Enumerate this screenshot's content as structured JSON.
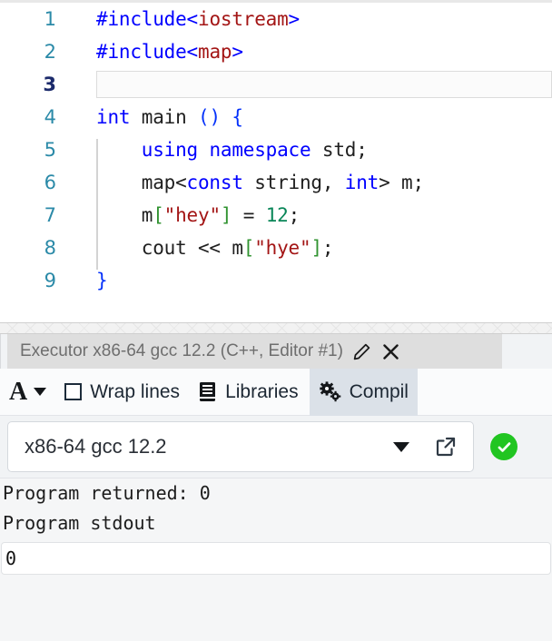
{
  "editor": {
    "active_line": 3,
    "lines": [
      {
        "num": "1",
        "tokens": [
          {
            "t": "#include",
            "c": "pre"
          },
          {
            "t": "<",
            "c": "pre"
          },
          {
            "t": "iostream",
            "c": "str"
          },
          {
            "t": ">",
            "c": "pre"
          }
        ]
      },
      {
        "num": "2",
        "tokens": [
          {
            "t": "#include",
            "c": "pre"
          },
          {
            "t": "<",
            "c": "pre"
          },
          {
            "t": "map",
            "c": "str"
          },
          {
            "t": ">",
            "c": "pre"
          }
        ]
      },
      {
        "num": "3",
        "tokens": []
      },
      {
        "num": "4",
        "tokens": [
          {
            "t": "int",
            "c": "key"
          },
          {
            "t": " main ",
            "c": "plain"
          },
          {
            "t": "()",
            "c": "brace"
          },
          {
            "t": " ",
            "c": "plain"
          },
          {
            "t": "{",
            "c": "brace"
          }
        ]
      },
      {
        "num": "5",
        "tokens": [
          {
            "t": "    ",
            "c": "plain"
          },
          {
            "t": "using namespace",
            "c": "key"
          },
          {
            "t": " std;",
            "c": "plain"
          }
        ]
      },
      {
        "num": "6",
        "tokens": [
          {
            "t": "    map<",
            "c": "plain"
          },
          {
            "t": "const",
            "c": "key"
          },
          {
            "t": " string, ",
            "c": "plain"
          },
          {
            "t": "int",
            "c": "key"
          },
          {
            "t": "> m;",
            "c": "plain"
          }
        ]
      },
      {
        "num": "7",
        "tokens": [
          {
            "t": "    m",
            "c": "plain"
          },
          {
            "t": "[",
            "c": "brk"
          },
          {
            "t": "\"hey\"",
            "c": "str"
          },
          {
            "t": "]",
            "c": "brk"
          },
          {
            "t": " = ",
            "c": "plain"
          },
          {
            "t": "12",
            "c": "num"
          },
          {
            "t": ";",
            "c": "plain"
          }
        ]
      },
      {
        "num": "8",
        "tokens": [
          {
            "t": "    cout << m",
            "c": "plain"
          },
          {
            "t": "[",
            "c": "brk"
          },
          {
            "t": "\"hye\"",
            "c": "str"
          },
          {
            "t": "]",
            "c": "brk"
          },
          {
            "t": ";",
            "c": "plain"
          }
        ]
      },
      {
        "num": "9",
        "tokens": [
          {
            "t": "}",
            "c": "brace"
          }
        ]
      }
    ],
    "colors": {
      "keyword": "#0000ff",
      "preprocessor": "#0000ff",
      "string": "#a31515",
      "number": "#098658",
      "bracket": "#319331",
      "brace": "#0431fa",
      "plain": "#1f1f1f",
      "line_number": "#2b8aa8",
      "line_number_active": "#1b2a6b"
    }
  },
  "executor": {
    "title": "Executor x86-64 gcc 12.2 (C++, Editor #1)",
    "edit_icon": "pencil-icon",
    "close_icon": "close-icon",
    "toolbar": {
      "font_label": "A",
      "wrap_lines_label": "Wrap lines",
      "wrap_lines_checked": false,
      "libraries_label": "Libraries",
      "libraries_icon": "book-icon",
      "compilation_label": "Compil",
      "compilation_icon": "gears-icon"
    },
    "compiler": {
      "name": "x86-64 gcc 12.2",
      "caret_icon": "chevron-down-icon",
      "popout_icon": "external-link-icon",
      "status_icon": "check-circle-icon",
      "status_color": "#21c521"
    },
    "output": {
      "returned_line": "Program returned: 0",
      "stdout_label": "Program stdout",
      "stdout_value": "0"
    }
  }
}
